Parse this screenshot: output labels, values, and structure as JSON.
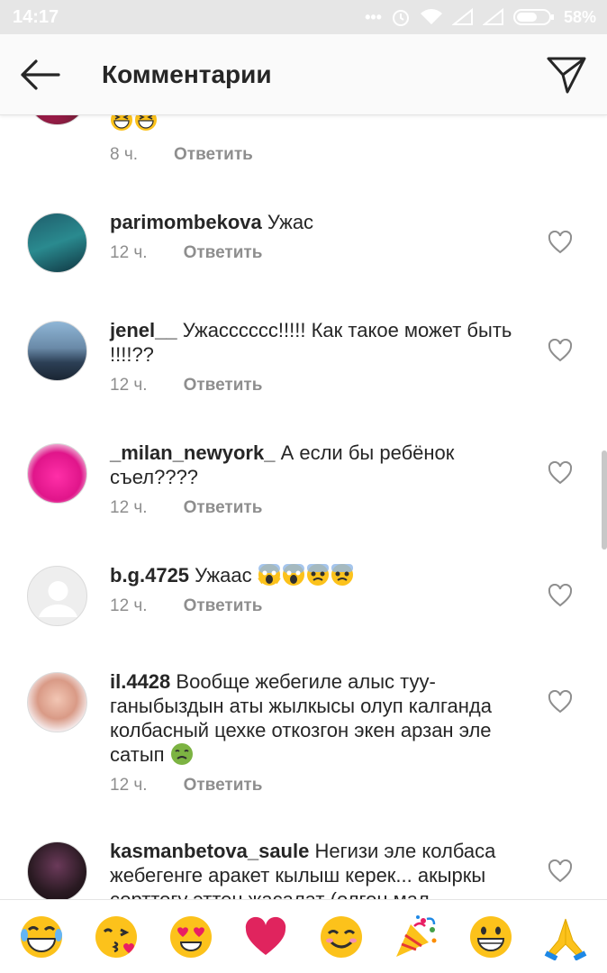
{
  "status_bar": {
    "time": "14:17",
    "battery": "58%"
  },
  "header": {
    "title": "Комментарии",
    "back_icon": "arrow-left-icon",
    "send_icon": "paper-plane-icon"
  },
  "comments": [
    {
      "username": "",
      "text": "",
      "time": "8 ч.",
      "reply_label": "Ответить",
      "emoji": [
        "grinning-squint",
        "grinning-squint"
      ]
    },
    {
      "username": "parimombekova",
      "text": "Ужас",
      "time": "12 ч.",
      "reply_label": "Ответить"
    },
    {
      "username": "jenel__",
      "text": "Ужасссссс!!!!! Как такое может быть !!!!??",
      "time": "12 ч.",
      "reply_label": "Ответить"
    },
    {
      "username": "_milan_newyork_",
      "text": "А если бы ребёнок съел????",
      "time": "12 ч.",
      "reply_label": "Ответить"
    },
    {
      "username": "b.g.4725",
      "text": "Ужаас",
      "time": "12 ч.",
      "reply_label": "Ответить",
      "emoji": [
        "screaming-face",
        "screaming-face",
        "fearful-face",
        "fearful-face"
      ]
    },
    {
      "username": "il.4428",
      "text": "Вообще жебегиле алыс туу­ганыбыздын аты жылкысы олуп калганда колбасный цехке откозгон экен арзан эле сатып",
      "time": "12 ч.",
      "reply_label": "Ответить",
      "emoji": [
        "nauseated-face"
      ]
    },
    {
      "username": "kasmanbetova_saule",
      "text": "Негизи эле колбаса жебегенге аракет кылыш керек... акыркы сорттогу эттен жасалат (олгон мал",
      "time": "",
      "reply_label": ""
    }
  ],
  "emoji_bar": [
    "face-with-tears-of-joy",
    "kissing-heart",
    "heart-eyes",
    "red-heart",
    "smiling-face",
    "party-popper",
    "grinning-face",
    "folded-hands"
  ],
  "colors": {
    "text": "#262626",
    "secondary": "#8e8e8e",
    "status_bar": "#e6e6e6",
    "header_bg": "#fafafa",
    "heart": "#e0245e",
    "emoji_yellow": "#fcc21b"
  }
}
